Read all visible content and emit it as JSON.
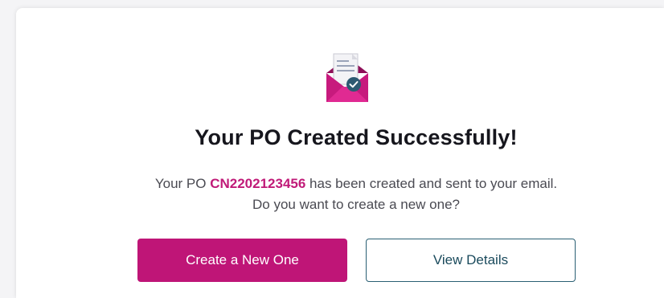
{
  "dialog": {
    "icon": "envelope-check-icon",
    "title": "Your PO Created Successfully!",
    "message_prefix": "Your PO ",
    "po_number": "CN2202123456",
    "message_suffix": " has been created and sent to your email.",
    "message_line2": "Do you want to create a new one?",
    "primary_button": "Create a New One",
    "secondary_button": "View Details"
  },
  "colors": {
    "accent": "#bf1577",
    "secondary_border": "#2a5f73",
    "icon_check_circle": "#2d5a72"
  }
}
